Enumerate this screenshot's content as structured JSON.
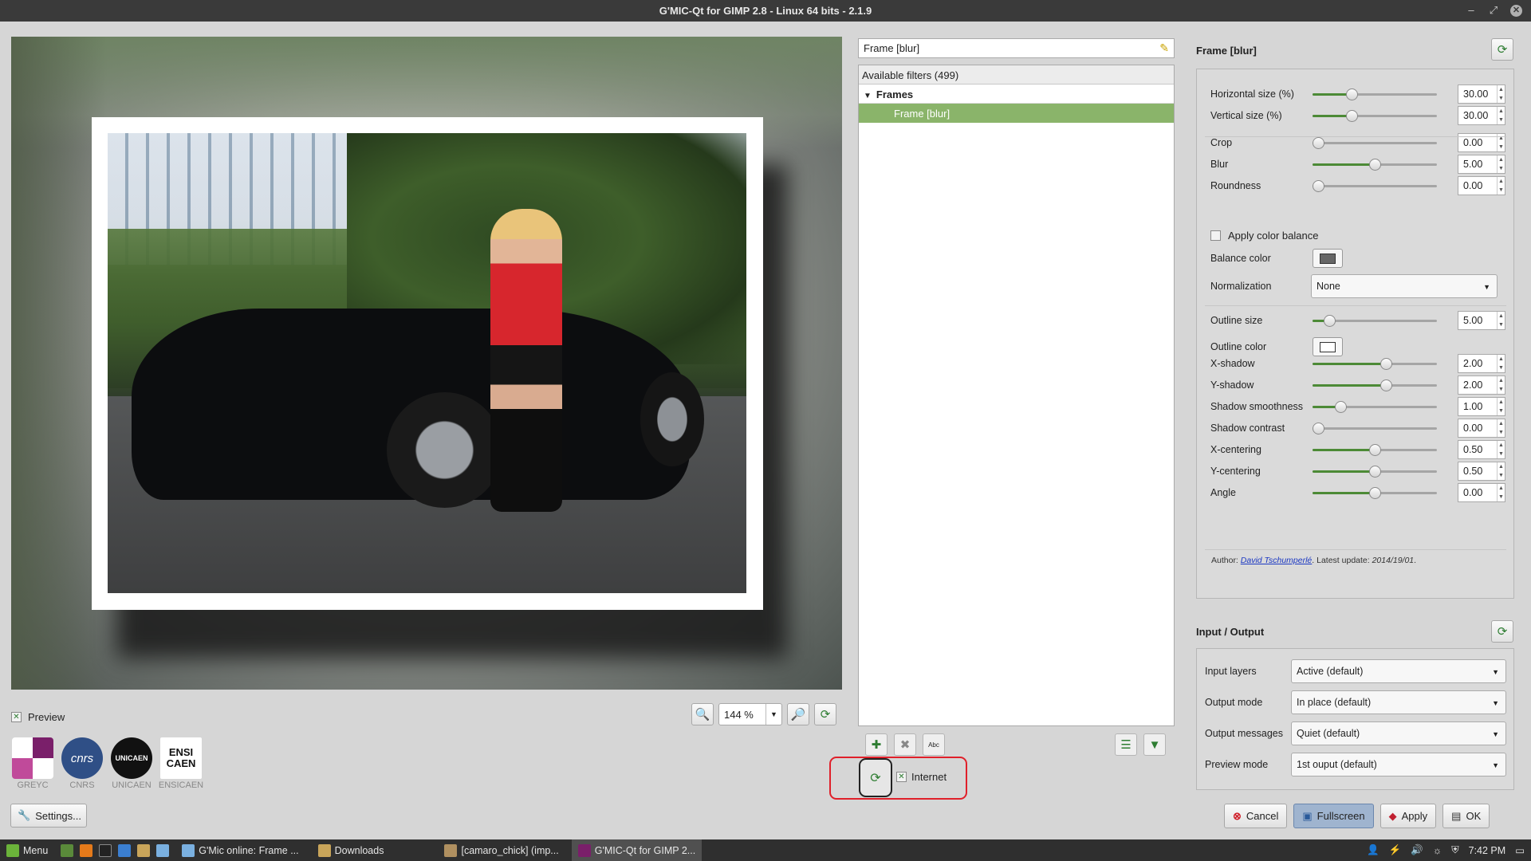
{
  "window": {
    "title": "G'MIC-Qt for GIMP 2.8 - Linux 64 bits - 2.1.9",
    "controls": [
      "–",
      "⤢",
      "✕"
    ]
  },
  "preview": {
    "checkbox_label": "Preview",
    "checked": true,
    "zoom_value": "144 %"
  },
  "logos": [
    {
      "name": "GREYC",
      "caption": "GREYC"
    },
    {
      "name": "CNRS",
      "caption": "CNRS",
      "text": "cnrs"
    },
    {
      "name": "UNICAEN",
      "caption": "UNICAEN",
      "text": "UNICAEN"
    },
    {
      "name": "ENSICAEN",
      "caption": "ENSICAEN",
      "text": "ENSI CAEN"
    }
  ],
  "settings_button": "Settings...",
  "filter_search": {
    "value": "Frame [blur]"
  },
  "filter_list": {
    "header": "Available filters (499)",
    "category": "Frames",
    "selected_item": "Frame [blur]"
  },
  "internet": {
    "label": "Internet",
    "checked": true
  },
  "params": {
    "title": "Frame [blur]",
    "rows": [
      {
        "label": "Horizontal size (%)",
        "value": "30.00",
        "fraction": 0.3
      },
      {
        "label": "Vertical size (%)",
        "value": "30.00",
        "fraction": 0.3
      },
      {
        "label": "Crop",
        "value": "0.00",
        "fraction": 0.0
      },
      {
        "label": "Blur",
        "value": "5.00",
        "fraction": 0.5
      },
      {
        "label": "Roundness",
        "value": "0.00",
        "fraction": 0.0
      }
    ],
    "apply_color_balance": "Apply color balance",
    "balance_color_label": "Balance color",
    "normalization_label": "Normalization",
    "normalization_value": "None",
    "outline_size_label": "Outline size",
    "outline_size_value": "5.00",
    "outline_size_fraction": 0.1,
    "outline_color_label": "Outline color",
    "shadow_rows": [
      {
        "label": "X-shadow",
        "value": "2.00",
        "fraction": 0.6
      },
      {
        "label": "Y-shadow",
        "value": "2.00",
        "fraction": 0.6
      },
      {
        "label": "Shadow smoothness",
        "value": "1.00",
        "fraction": 0.2
      },
      {
        "label": "Shadow contrast",
        "value": "0.00",
        "fraction": 0.0
      },
      {
        "label": "X-centering",
        "value": "0.50",
        "fraction": 0.5
      },
      {
        "label": "Y-centering",
        "value": "0.50",
        "fraction": 0.5
      },
      {
        "label": "Angle",
        "value": "0.00",
        "fraction": 0.5
      }
    ],
    "author_prefix": "Author: ",
    "author_name": "David Tschumperlé",
    "author_mid": ". Latest update: ",
    "author_date": "2014/19/01",
    "author_end": "."
  },
  "io": {
    "title": "Input / Output",
    "rows": [
      {
        "label": "Input layers",
        "value": "Active (default)"
      },
      {
        "label": "Output mode",
        "value": "In place (default)"
      },
      {
        "label": "Output messages",
        "value": "Quiet (default)"
      },
      {
        "label": "Preview mode",
        "value": "1st ouput (default)"
      }
    ]
  },
  "buttons": {
    "cancel": "Cancel",
    "fullscreen": "Fullscreen",
    "apply": "Apply",
    "ok": "OK"
  },
  "taskbar": {
    "menu": "Menu",
    "tasks": [
      "G'Mic online: Frame ...",
      "Downloads",
      "[camaro_chick] (imp...",
      "G'MIC-Qt for GIMP 2..."
    ],
    "clock": "7:42 PM"
  },
  "colors": {
    "accent_green": "#8ab46a",
    "highlight_red": "#e0202a"
  }
}
